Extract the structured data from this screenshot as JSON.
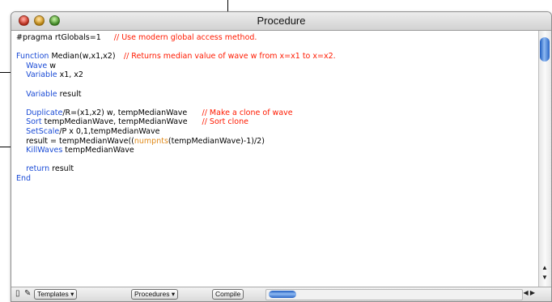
{
  "window": {
    "title": "Procedure"
  },
  "code_lines": [
    [
      {
        "t": "#pragma rtGlobals=1",
        "c": ""
      },
      {
        "t": "\t\t// Use modern global access method.",
        "c": "red"
      }
    ],
    [],
    [
      {
        "t": "Function",
        "c": "blue"
      },
      {
        "t": " Median(w,x1,x2)",
        "c": ""
      },
      {
        "t": "\t// Returns median value of wave w from x=x1 to x=x2.",
        "c": "red"
      }
    ],
    [
      {
        "t": "\tWave",
        "c": "blue"
      },
      {
        "t": " w",
        "c": ""
      }
    ],
    [
      {
        "t": "\tVariable",
        "c": "blue"
      },
      {
        "t": " x1, x2",
        "c": ""
      }
    ],
    [],
    [
      {
        "t": "\tVariable",
        "c": "blue"
      },
      {
        "t": " result",
        "c": ""
      }
    ],
    [],
    [
      {
        "t": "\tDuplicate",
        "c": "blue"
      },
      {
        "t": "/R=(x1,x2) w, tempMedianWave",
        "c": ""
      },
      {
        "t": "\t\t// Make a clone of wave",
        "c": "red"
      }
    ],
    [
      {
        "t": "\tSort",
        "c": "blue"
      },
      {
        "t": " tempMedianWave, tempMedianWave",
        "c": ""
      },
      {
        "t": "\t\t// Sort clone",
        "c": "red"
      }
    ],
    [
      {
        "t": "\tSetScale",
        "c": "blue"
      },
      {
        "t": "/P x 0,1,tempMedianWave",
        "c": ""
      }
    ],
    [
      {
        "t": "\tresult = tempMedianWave((",
        "c": ""
      },
      {
        "t": "numpnts",
        "c": "orange"
      },
      {
        "t": "(tempMedianWave)-1)/2)",
        "c": ""
      }
    ],
    [
      {
        "t": "\tKillWaves",
        "c": "blue"
      },
      {
        "t": " tempMedianWave",
        "c": ""
      }
    ],
    [],
    [
      {
        "t": "\treturn",
        "c": "blue"
      },
      {
        "t": " result",
        "c": ""
      }
    ],
    [
      {
        "t": "End",
        "c": "blue"
      }
    ]
  ],
  "bottombar": {
    "templates_label": "Templates ▾",
    "procedures_label": "Procedures ▾",
    "compile_label": "Compile"
  },
  "colors": {
    "keyword": "#1a4bd6",
    "comment": "#ff1a00",
    "function": "#e08a1a"
  }
}
